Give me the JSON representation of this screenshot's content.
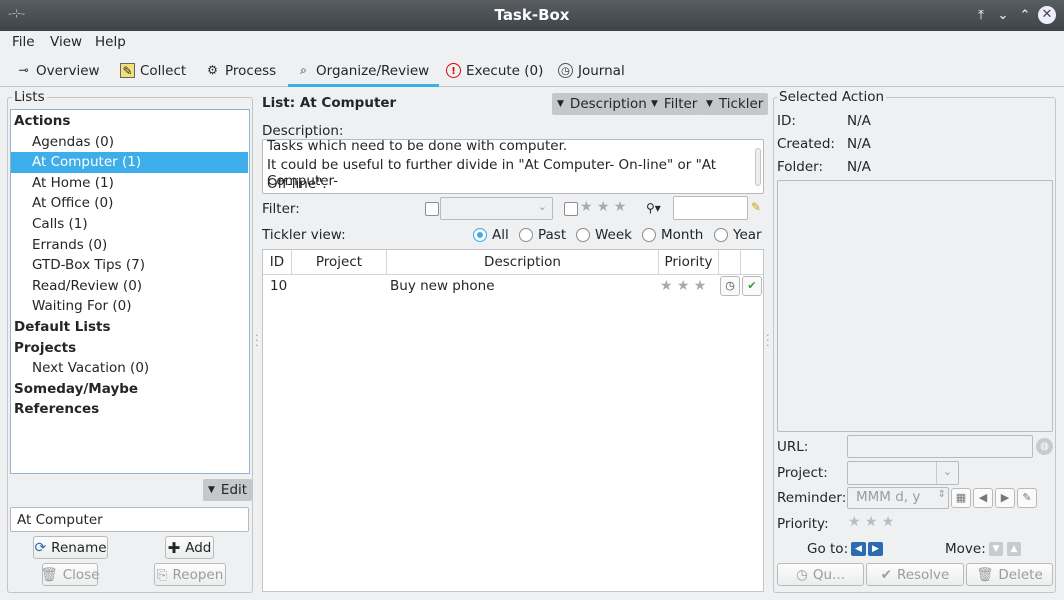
{
  "window": {
    "title": "Task-Box"
  },
  "menu": [
    "File",
    "View",
    "Help"
  ],
  "tabs": [
    {
      "label": "Overview",
      "icon": "overview-icon"
    },
    {
      "label": "Collect",
      "icon": "collect-icon"
    },
    {
      "label": "Process",
      "icon": "process-icon"
    },
    {
      "label": "Organize/Review",
      "icon": "organize-icon",
      "active": true
    },
    {
      "label": "Execute (0)",
      "icon": "execute-icon"
    },
    {
      "label": "Journal",
      "icon": "journal-icon"
    }
  ],
  "lists": {
    "group_label": "Lists",
    "items": [
      {
        "label": "Actions",
        "bold": true
      },
      {
        "label": "Agendas (0)"
      },
      {
        "label": "At Computer (1)",
        "selected": true
      },
      {
        "label": "At Home (1)"
      },
      {
        "label": "At Office (0)"
      },
      {
        "label": "Calls (1)"
      },
      {
        "label": "Errands (0)"
      },
      {
        "label": "GTD-Box Tips (7)"
      },
      {
        "label": "Read/Review (0)"
      },
      {
        "label": "Waiting For (0)"
      },
      {
        "label": "Default Lists",
        "bold": true
      },
      {
        "label": "Projects",
        "bold": true
      },
      {
        "label": "Next Vacation (0)"
      },
      {
        "label": "Someday/Maybe",
        "bold": true
      },
      {
        "label": "References",
        "bold": true
      }
    ],
    "edit_label": "Edit",
    "name_value": "At Computer",
    "rename_label": "Rename",
    "add_label": "Add",
    "close_label": "Close",
    "reopen_label": "Reopen"
  },
  "center": {
    "list_title": "List: At Computer",
    "description_btn": "Description",
    "filter_btn": "Filter",
    "tickler_btn": "Tickler",
    "description_label": "Description:",
    "description_lines": [
      "Tasks which need to be done with computer.",
      "It could be useful to further divide in \"At Computer- On-line\" or \"At Computer-",
      "Off-line\"."
    ],
    "filter_label": "Filter:",
    "tickler_label": "Tickler view:",
    "tickler_options": [
      "All",
      "Past",
      "Week",
      "Month",
      "Year"
    ],
    "tickler_selected": "All",
    "columns": [
      "ID",
      "Project",
      "Description",
      "Priority"
    ],
    "rows": [
      {
        "id": "10",
        "project": "",
        "description": "Buy new phone",
        "priority_stars": 0
      }
    ]
  },
  "selected_action": {
    "group_label": "Selected Action",
    "id_label": "ID:",
    "id_value": "N/A",
    "created_label": "Created:",
    "created_value": "N/A",
    "folder_label": "Folder:",
    "folder_value": "N/A",
    "url_label": "URL:",
    "project_label": "Project:",
    "reminder_label": "Reminder:",
    "reminder_placeholder": "MMM d, y",
    "priority_label": "Priority:",
    "goto_label": "Go to:",
    "move_label": "Move:",
    "queue_label": "Qu...",
    "resolve_label": "Resolve",
    "delete_label": "Delete"
  }
}
